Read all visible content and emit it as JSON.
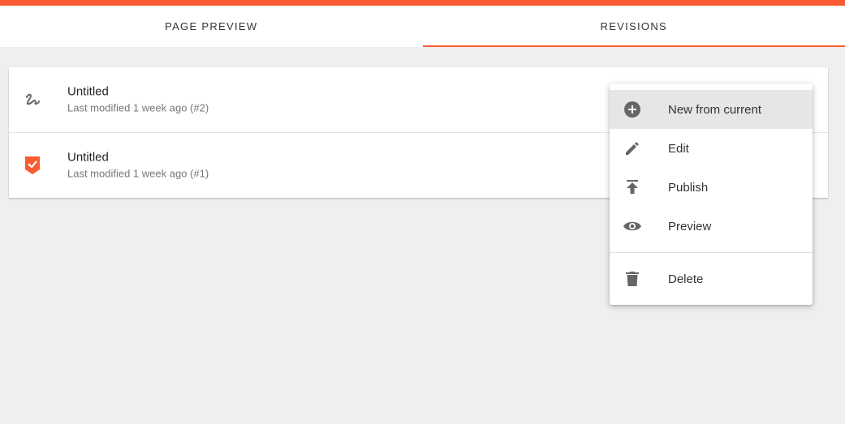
{
  "accent_color": "#fb5b30",
  "tabs": [
    {
      "label": "PAGE PREVIEW",
      "active": false
    },
    {
      "label": "REVISIONS",
      "active": true
    }
  ],
  "revisions": [
    {
      "title": "Untitled",
      "subtitle": "Last modified 1 week ago (#2)",
      "icon": "draft-squiggle-icon"
    },
    {
      "title": "Untitled",
      "subtitle": "Last modified 1 week ago (#1)",
      "icon": "published-check-badge-icon"
    }
  ],
  "menu": {
    "items": [
      {
        "label": "New from current",
        "icon": "add-circle-icon",
        "highlighted": true
      },
      {
        "label": "Edit",
        "icon": "pencil-icon"
      },
      {
        "label": "Publish",
        "icon": "publish-icon"
      },
      {
        "label": "Preview",
        "icon": "eye-icon"
      }
    ],
    "danger_items": [
      {
        "label": "Delete",
        "icon": "trash-icon"
      }
    ]
  }
}
